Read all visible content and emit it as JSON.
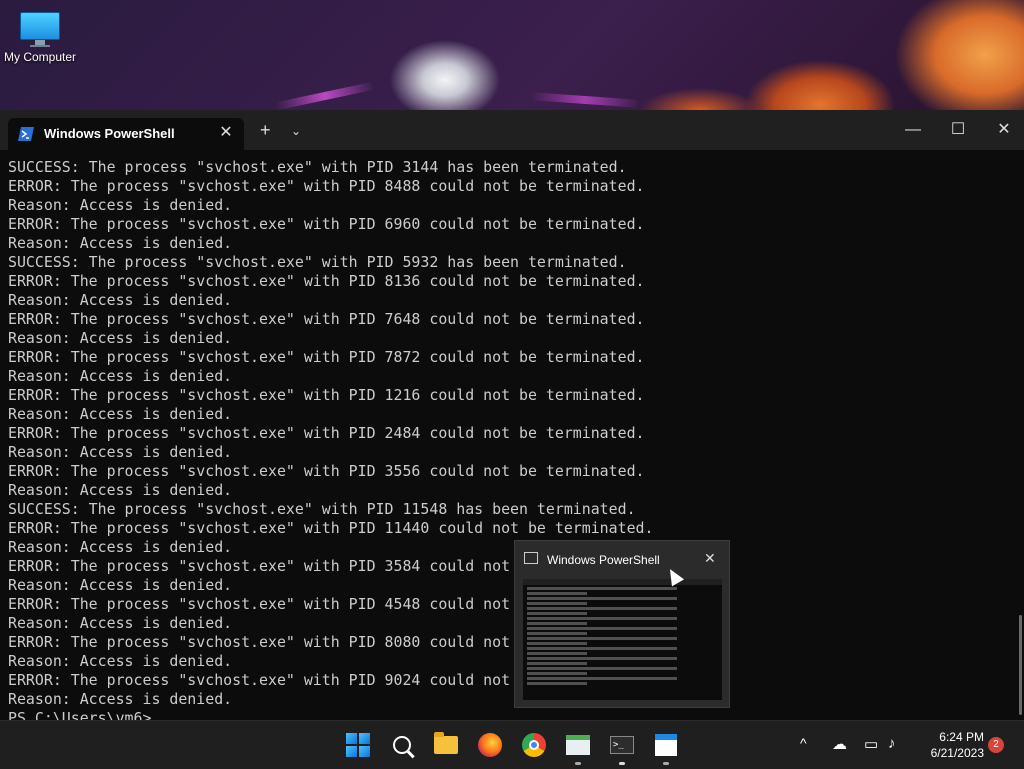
{
  "desktop": {
    "icon_label": "My Computer"
  },
  "window": {
    "tab_title": "Windows PowerShell",
    "tab_close": "✕",
    "new_tab": "+",
    "tab_dropdown": "⌄",
    "minimize": "—",
    "maximize": "☐",
    "close": "✕"
  },
  "console": {
    "lines": [
      "SUCCESS: The process \"svchost.exe\" with PID 3144 has been terminated.",
      "ERROR: The process \"svchost.exe\" with PID 8488 could not be terminated.",
      "Reason: Access is denied.",
      "ERROR: The process \"svchost.exe\" with PID 6960 could not be terminated.",
      "Reason: Access is denied.",
      "SUCCESS: The process \"svchost.exe\" with PID 5932 has been terminated.",
      "ERROR: The process \"svchost.exe\" with PID 8136 could not be terminated.",
      "Reason: Access is denied.",
      "ERROR: The process \"svchost.exe\" with PID 7648 could not be terminated.",
      "Reason: Access is denied.",
      "ERROR: The process \"svchost.exe\" with PID 7872 could not be terminated.",
      "Reason: Access is denied.",
      "ERROR: The process \"svchost.exe\" with PID 1216 could not be terminated.",
      "Reason: Access is denied.",
      "ERROR: The process \"svchost.exe\" with PID 2484 could not be terminated.",
      "Reason: Access is denied.",
      "ERROR: The process \"svchost.exe\" with PID 3556 could not be terminated.",
      "Reason: Access is denied.",
      "SUCCESS: The process \"svchost.exe\" with PID 11548 has been terminated.",
      "ERROR: The process \"svchost.exe\" with PID 11440 could not be terminated.",
      "Reason: Access is denied.",
      "ERROR: The process \"svchost.exe\" with PID 3584 could not",
      "Reason: Access is denied.",
      "ERROR: The process \"svchost.exe\" with PID 4548 could not",
      "Reason: Access is denied.",
      "ERROR: The process \"svchost.exe\" with PID 8080 could not",
      "Reason: Access is denied.",
      "ERROR: The process \"svchost.exe\" with PID 9024 could not",
      "Reason: Access is denied.",
      "PS C:\\Users\\vm6>"
    ]
  },
  "preview": {
    "title": "Windows PowerShell",
    "close": "✕"
  },
  "taskbar": {
    "items": [
      {
        "name": "start-button",
        "icon": "windows-logo-icon"
      },
      {
        "name": "search-button",
        "icon": "search-icon"
      },
      {
        "name": "file-explorer",
        "icon": "folder-icon"
      },
      {
        "name": "firefox",
        "icon": "firefox-icon"
      },
      {
        "name": "chrome",
        "icon": "chrome-icon"
      },
      {
        "name": "app-window",
        "icon": "app-window-icon"
      },
      {
        "name": "windows-terminal",
        "icon": "terminal-icon"
      },
      {
        "name": "notepad",
        "icon": "notepad-icon"
      }
    ],
    "tray": {
      "chevron": "^",
      "clock_time": "6:24 PM",
      "clock_date": "6/21/2023",
      "notification_count": "2"
    }
  },
  "colors": {
    "terminal_bg": "#0c0c0c",
    "terminal_text": "#cccccc",
    "titlebar": "#202020",
    "taskbar": "#1f1f1f",
    "badge": "#d9453b"
  }
}
